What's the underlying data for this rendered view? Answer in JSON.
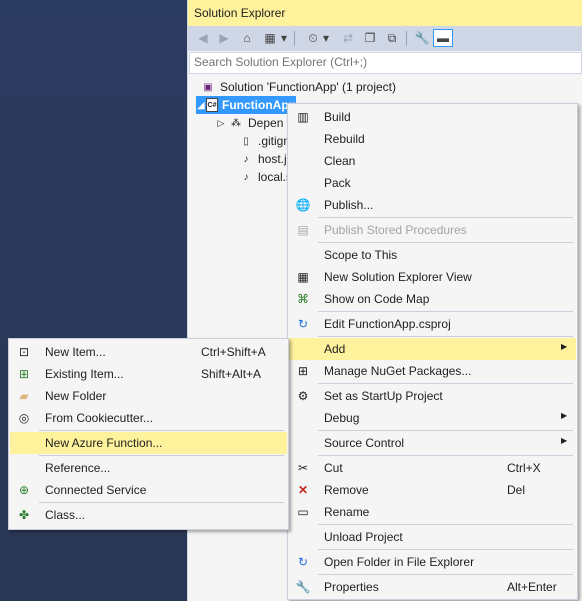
{
  "solution_explorer": {
    "title": "Solution Explorer",
    "search_placeholder": "Search Solution Explorer (Ctrl+;)",
    "tree": [
      {
        "label": "Solution 'FunctionApp' (1 project)"
      },
      {
        "label": "FunctionApp"
      },
      {
        "label": "Depen"
      },
      {
        "label": ".gitign"
      },
      {
        "label": "host.js"
      },
      {
        "label": "local.s"
      }
    ]
  },
  "context_menu": {
    "items": [
      {
        "label": "Build",
        "icon": "build-icon"
      },
      {
        "label": "Rebuild"
      },
      {
        "label": "Clean"
      },
      {
        "label": "Pack"
      },
      {
        "label": "Publish...",
        "icon": "globe-icon"
      },
      {
        "label": "Publish Stored Procedures",
        "icon": "database-icon"
      },
      {
        "label": "Scope to This"
      },
      {
        "label": "New Solution Explorer View",
        "icon": "new-view-icon"
      },
      {
        "label": "Show on Code Map",
        "icon": "code-map-icon"
      },
      {
        "label": "Edit FunctionApp.csproj",
        "icon": "edit-icon"
      },
      {
        "label": "Add"
      },
      {
        "label": "Manage NuGet Packages...",
        "icon": "nuget-icon"
      },
      {
        "label": "Set as StartUp Project",
        "icon": "gear-icon"
      },
      {
        "label": "Debug"
      },
      {
        "label": "Source Control"
      },
      {
        "label": "Cut",
        "shortcut": "Ctrl+X",
        "icon": "cut-icon"
      },
      {
        "label": "Remove",
        "shortcut": "Del",
        "icon": "remove-icon"
      },
      {
        "label": "Rename",
        "icon": "rename-icon"
      },
      {
        "label": "Unload Project"
      },
      {
        "label": "Open Folder in File Explorer",
        "icon": "refresh-icon"
      },
      {
        "label": "Properties",
        "shortcut": "Alt+Enter",
        "icon": "wrench-icon"
      }
    ]
  },
  "add_submenu": {
    "items": [
      {
        "label": "New Item...",
        "shortcut": "Ctrl+Shift+A",
        "icon": "new-item-icon"
      },
      {
        "label": "Existing Item...",
        "shortcut": "Shift+Alt+A",
        "icon": "existing-item-icon"
      },
      {
        "label": "New Folder",
        "icon": "folder-icon"
      },
      {
        "label": "From Cookiecutter...",
        "icon": "cookiecutter-icon"
      },
      {
        "label": "New Azure Function..."
      },
      {
        "label": "Reference..."
      },
      {
        "label": "Connected Service",
        "icon": "connected-service-icon"
      },
      {
        "label": "Class...",
        "icon": "class-icon"
      }
    ]
  },
  "colors": {
    "highlight": "#fff29d",
    "selection": "#3399ff",
    "menu_bg": "#f5f5f5",
    "background": "#2b3a5f"
  }
}
